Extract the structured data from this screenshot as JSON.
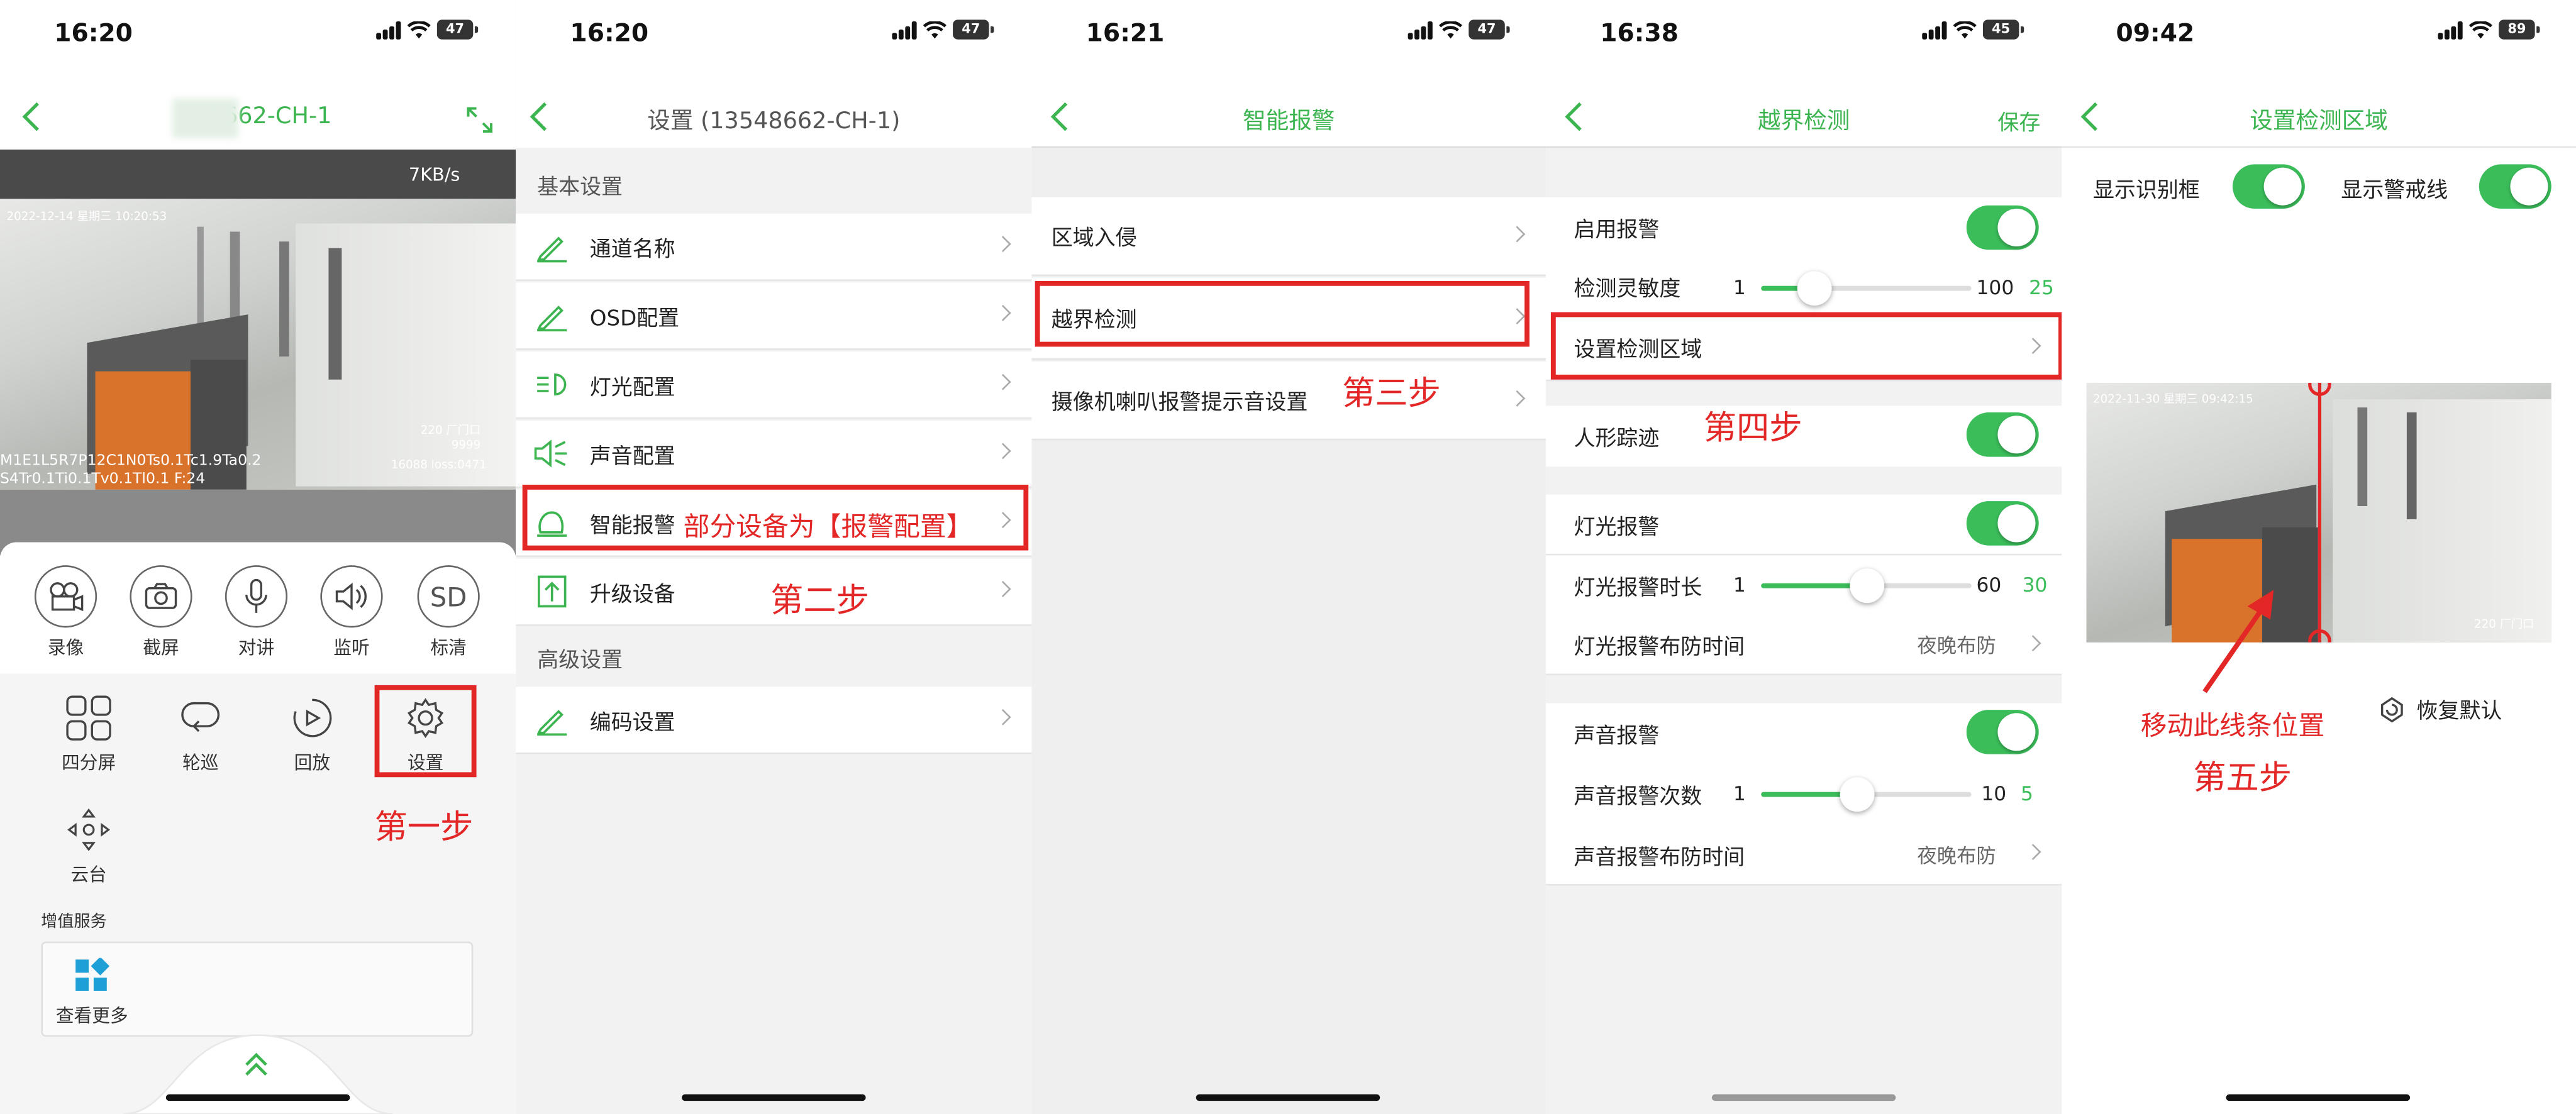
{
  "colors": {
    "accent": "#3cb550",
    "annotation": "#e32626",
    "toggle_on": "#3bbd5a"
  },
  "panel1": {
    "status": {
      "time": "16:20",
      "battery": "47"
    },
    "nav": {
      "title": "13662-CH-1"
    },
    "video": {
      "rate": "7KB/s",
      "overlay1": "2022-12-14  星期三  10:20:53",
      "overlay2": "M1E1L5R7P12C1N0Ts0.1Tc1.9Ta0.2",
      "overlay3": "S4Tr0.1Ti0.1Tv0.1Tl0.1  F:24",
      "overlay4": "220 厂门口\n9999",
      "overlay5": "16088  loss:0471"
    },
    "tools1": [
      {
        "label": "录像",
        "icon": "video-camera-icon"
      },
      {
        "label": "截屏",
        "icon": "camera-icon"
      },
      {
        "label": "对讲",
        "icon": "microphone-icon"
      },
      {
        "label": "监听",
        "icon": "speaker-icon"
      },
      {
        "label": "标清",
        "icon": "sd-icon",
        "glyph": "SD"
      }
    ],
    "tools2": [
      {
        "label": "四分屏",
        "icon": "grid-icon"
      },
      {
        "label": "轮巡",
        "icon": "cycle-icon"
      },
      {
        "label": "回放",
        "icon": "playback-icon"
      },
      {
        "label": "设置",
        "icon": "gear-icon"
      }
    ],
    "ptz": {
      "label": "云台"
    },
    "value_added": "增值服务",
    "more": {
      "label": "查看更多"
    },
    "step": "第一步"
  },
  "panel2": {
    "status": {
      "time": "16:20",
      "battery": "47"
    },
    "nav": {
      "title": "设置 (13548662-CH-1)"
    },
    "section_basic": "基本设置",
    "items": [
      {
        "label": "通道名称",
        "icon": "pencil-icon"
      },
      {
        "label": "OSD配置",
        "icon": "pencil-icon"
      },
      {
        "label": "灯光配置",
        "icon": "light-icon"
      },
      {
        "label": "声音配置",
        "icon": "sound-icon"
      },
      {
        "label": "智能报警",
        "icon": "alarm-icon"
      },
      {
        "label": "升级设备",
        "icon": "upgrade-icon"
      }
    ],
    "note": "部分设备为【报警配置】",
    "step": "第二步",
    "section_adv": "高级设置",
    "adv_items": [
      {
        "label": "编码设置",
        "icon": "pencil-icon"
      }
    ]
  },
  "panel3": {
    "status": {
      "time": "16:21",
      "battery": "47"
    },
    "nav": {
      "title": "智能报警"
    },
    "items": [
      "区域入侵",
      "越界检测",
      "摄像机喇叭报警提示音设置"
    ],
    "step": "第三步"
  },
  "panel4": {
    "status": {
      "time": "16:38",
      "battery": "45"
    },
    "nav": {
      "title": "越界检测",
      "save": "保存"
    },
    "enable_alarm": "启用报警",
    "sensitivity": {
      "label": "检测灵敏度",
      "min": "1",
      "max": "100",
      "value": "25",
      "fraction": 0.25
    },
    "set_area": "设置检测区域",
    "step": "第四步",
    "human_track": "人形踪迹",
    "light_alarm": "灯光报警",
    "light_duration": {
      "label": "灯光报警时长",
      "min": "1",
      "max": "60",
      "value": "30",
      "fraction": 0.5
    },
    "light_schedule": {
      "label": "灯光报警布防时间",
      "value": "夜晚布防"
    },
    "sound_alarm": "声音报警",
    "sound_count": {
      "label": "声音报警次数",
      "min": "1",
      "max": "10",
      "value": "5",
      "fraction": 0.45
    },
    "sound_schedule": {
      "label": "声音报警布防时间",
      "value": "夜晚布防"
    }
  },
  "panel5": {
    "status": {
      "time": "09:42",
      "battery": "89"
    },
    "nav": {
      "title": "设置检测区域"
    },
    "show_box": "显示识别框",
    "show_line": "显示警戒线",
    "overlay1": "2022-11-30  星期三  09:42:15",
    "overlay2": "220 厂门口",
    "restore": "恢复默认",
    "move_hint": "移动此线条位置",
    "step": "第五步"
  }
}
